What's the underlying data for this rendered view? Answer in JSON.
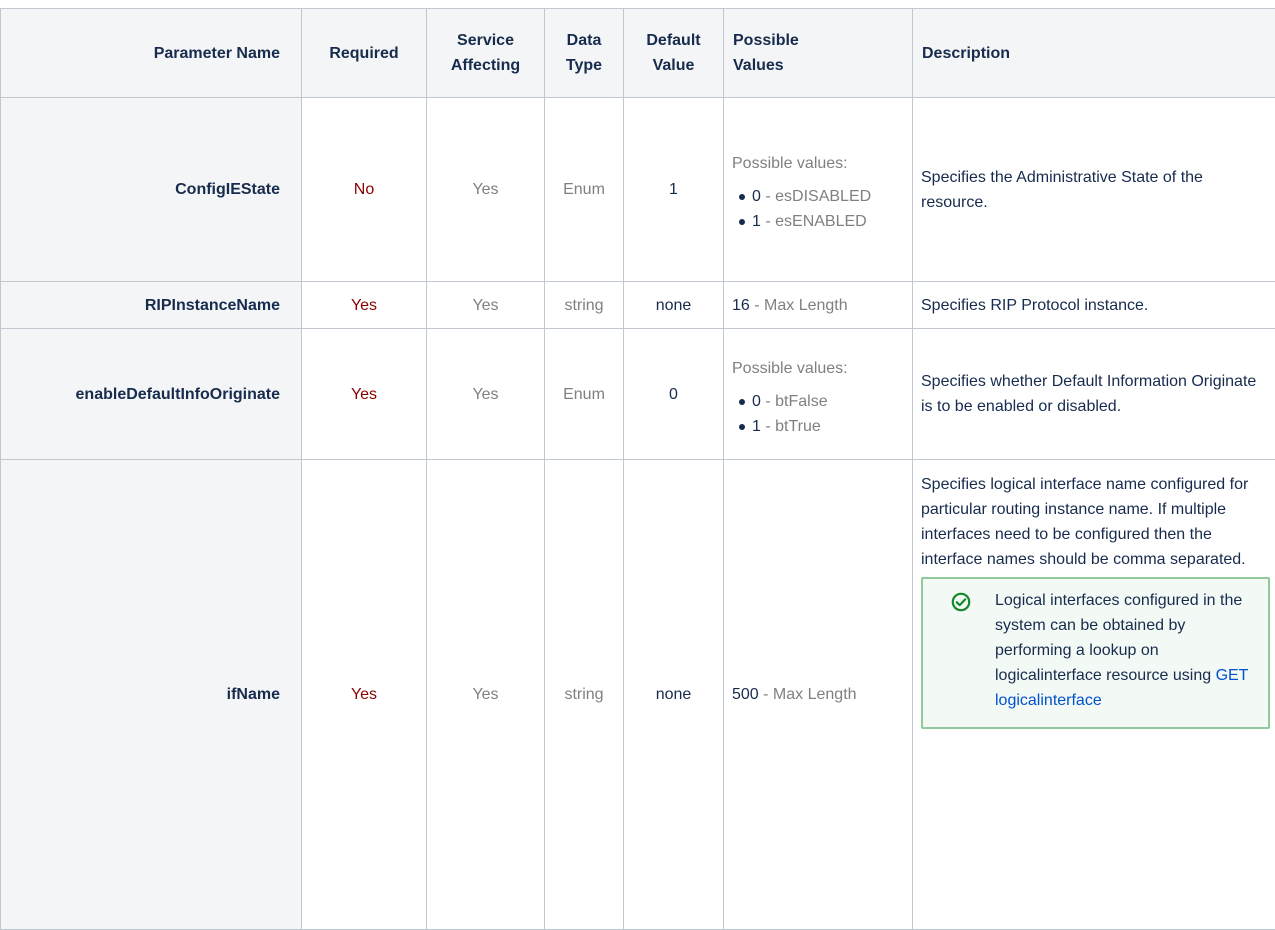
{
  "headers": {
    "parameter_name": "Parameter Name",
    "required": "Required",
    "service_affecting_1": "Service",
    "service_affecting_2": "Affecting",
    "data_type_1": "Data",
    "data_type_2": "Type",
    "default_value_1": "Default",
    "default_value_2": "Value",
    "possible_values_1": "Possible",
    "possible_values_2": "Values",
    "description": "Description"
  },
  "rows": [
    {
      "name": "ConfigIEState",
      "required": "No",
      "service_affecting": "Yes",
      "data_type": "Enum",
      "default_value": "1",
      "possible_values_label": "Possible values:",
      "options": [
        {
          "num": "0",
          "text": " - esDISABLED"
        },
        {
          "num": "1",
          "text": " - esENABLED"
        }
      ],
      "description": "Specifies the Administrative State of the resource."
    },
    {
      "name": "RIPInstanceName",
      "required": "Yes",
      "service_affecting": "Yes",
      "data_type": "string",
      "default_value": "none",
      "max_length_num": "16",
      "max_length_text": " - Max Length",
      "description": "Specifies RIP Protocol instance."
    },
    {
      "name": "enableDefaultInfoOriginate",
      "required": "Yes",
      "service_affecting": "Yes",
      "data_type": "Enum",
      "default_value": "0",
      "possible_values_label": "Possible values:",
      "options": [
        {
          "num": "0",
          "text": " - btFalse"
        },
        {
          "num": "1",
          "text": " - btTrue"
        }
      ],
      "description": "Specifies whether Default Information Originate is to be enabled or disabled."
    },
    {
      "name": "ifName",
      "required": "Yes",
      "service_affecting": "Yes",
      "data_type": "string",
      "default_value": "none",
      "max_length_num": "500",
      "max_length_text": " - Max Length",
      "description": "Specifies logical interface name configured for particular routing instance name. If multiple interfaces need to be configured then the interface names should be comma separated.",
      "tip": {
        "icon": "check-circle-icon",
        "text": "Logical interfaces configured in the system can be obtained by performing a lookup on logicalinterface resource using ",
        "link_text": "GET logicalinterface"
      }
    }
  ],
  "colors": {
    "header_bg": "#f4f5f7",
    "border": "#c1c7d0",
    "required_text": "#8b0000",
    "muted_text": "#808080",
    "link": "#0052cc",
    "tip_bg": "#f3f9f4",
    "tip_border": "#91c89c",
    "tip_icon": "#14892c"
  }
}
